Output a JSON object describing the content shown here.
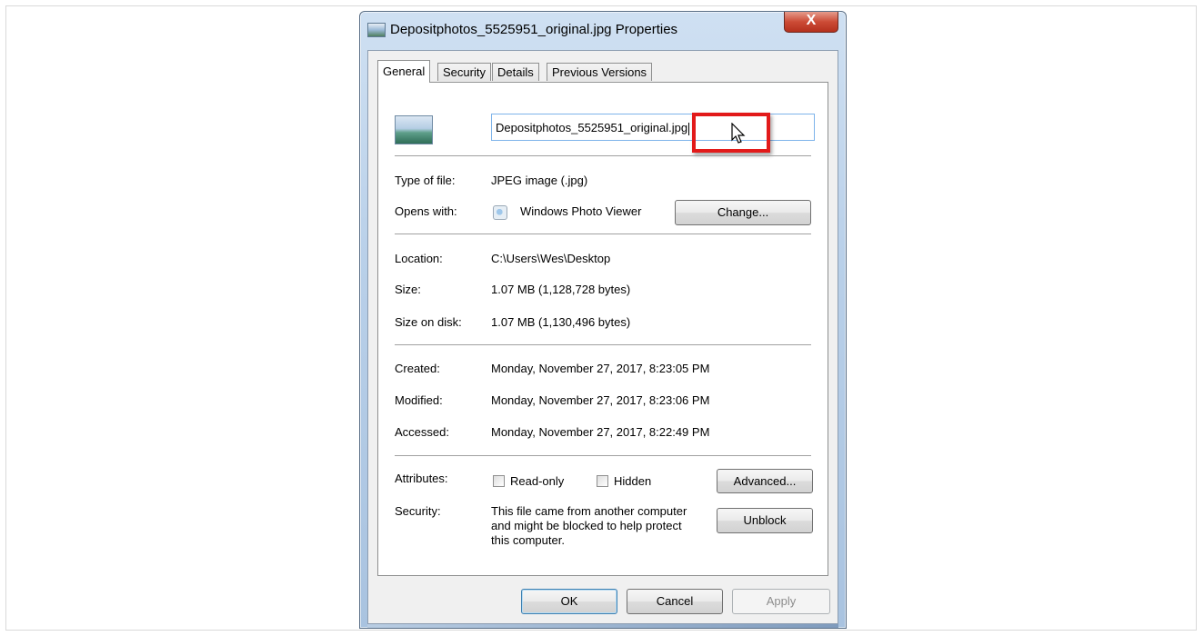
{
  "window": {
    "title": "Depositphotos_5525951_original.jpg Properties",
    "close_glyph": "X"
  },
  "tabs": [
    {
      "label": "General",
      "active": true
    },
    {
      "label": "Security",
      "active": false
    },
    {
      "label": "Details",
      "active": false
    },
    {
      "label": "Previous Versions",
      "active": false
    }
  ],
  "file": {
    "icon": "jpeg-image-icon",
    "name_value_before": "Depositphotos_5525951_original.",
    "name_value_selected": "jpg"
  },
  "general": {
    "type_label": "Type of file:",
    "type_value": "JPEG image (.jpg)",
    "opens_label": "Opens with:",
    "opens_icon": "photo-viewer-icon",
    "opens_value": "Windows Photo Viewer",
    "change_button": "Change..."
  },
  "location": {
    "location_label": "Location:",
    "location_value": "C:\\Users\\Wes\\Desktop",
    "size_label": "Size:",
    "size_value": "1.07 MB (1,128,728 bytes)",
    "size_disk_label": "Size on disk:",
    "size_disk_value": "1.07 MB (1,130,496 bytes)"
  },
  "dates": {
    "created_label": "Created:",
    "created_value": "Monday, November 27, 2017, 8:23:05 PM",
    "modified_label": "Modified:",
    "modified_value": "Monday, November 27, 2017, 8:23:06 PM",
    "accessed_label": "Accessed:",
    "accessed_value": "Monday, November 27, 2017, 8:22:49 PM"
  },
  "attributes": {
    "label": "Attributes:",
    "readonly_label": "Read-only",
    "readonly_checked": false,
    "hidden_label": "Hidden",
    "hidden_checked": false,
    "advanced_button": "Advanced..."
  },
  "security": {
    "label": "Security:",
    "line1": "This file came from another computer",
    "line2": "and might be blocked to help protect",
    "line3": "this computer.",
    "unblock_button": "Unblock"
  },
  "footer": {
    "ok": "OK",
    "cancel": "Cancel",
    "apply": "Apply"
  },
  "colors": {
    "highlight_box": "#e21a1a",
    "window_frame": "#b9d0e9",
    "close_button": "#cc4b36"
  }
}
